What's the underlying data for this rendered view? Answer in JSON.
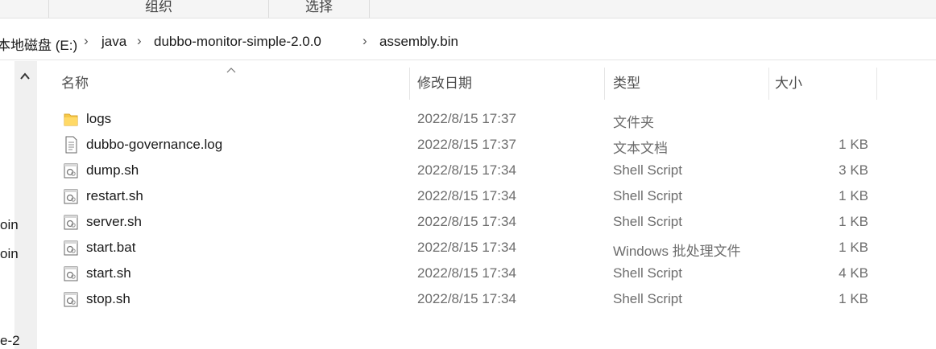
{
  "ribbon": {
    "groups": [
      "组织",
      "选择"
    ]
  },
  "address": {
    "path": [
      "本地磁盘 (E:)",
      "java",
      "dubbo-monitor-simple-2.0.0",
      "assembly.bin"
    ]
  },
  "nav_fragments": [
    "oin",
    "oin",
    "e-2"
  ],
  "columns": {
    "name": "名称",
    "date": "修改日期",
    "type": "类型",
    "size": "大小"
  },
  "files": [
    {
      "name": "logs",
      "date": "2022/8/15 17:37",
      "type": "文件夹",
      "size": "",
      "icon": "folder-icon"
    },
    {
      "name": "dubbo-governance.log",
      "date": "2022/8/15 17:37",
      "type": "文本文档",
      "size": "1 KB",
      "icon": "text-file-icon"
    },
    {
      "name": "dump.sh",
      "date": "2022/8/15 17:34",
      "type": "Shell Script",
      "size": "3 KB",
      "icon": "script-file-icon"
    },
    {
      "name": "restart.sh",
      "date": "2022/8/15 17:34",
      "type": "Shell Script",
      "size": "1 KB",
      "icon": "script-file-icon"
    },
    {
      "name": "server.sh",
      "date": "2022/8/15 17:34",
      "type": "Shell Script",
      "size": "1 KB",
      "icon": "script-file-icon"
    },
    {
      "name": "start.bat",
      "date": "2022/8/15 17:34",
      "type": "Windows 批处理文件",
      "size": "1 KB",
      "icon": "script-file-icon"
    },
    {
      "name": "start.sh",
      "date": "2022/8/15 17:34",
      "type": "Shell Script",
      "size": "4 KB",
      "icon": "script-file-icon"
    },
    {
      "name": "stop.sh",
      "date": "2022/8/15 17:34",
      "type": "Shell Script",
      "size": "1 KB",
      "icon": "script-file-icon"
    }
  ]
}
